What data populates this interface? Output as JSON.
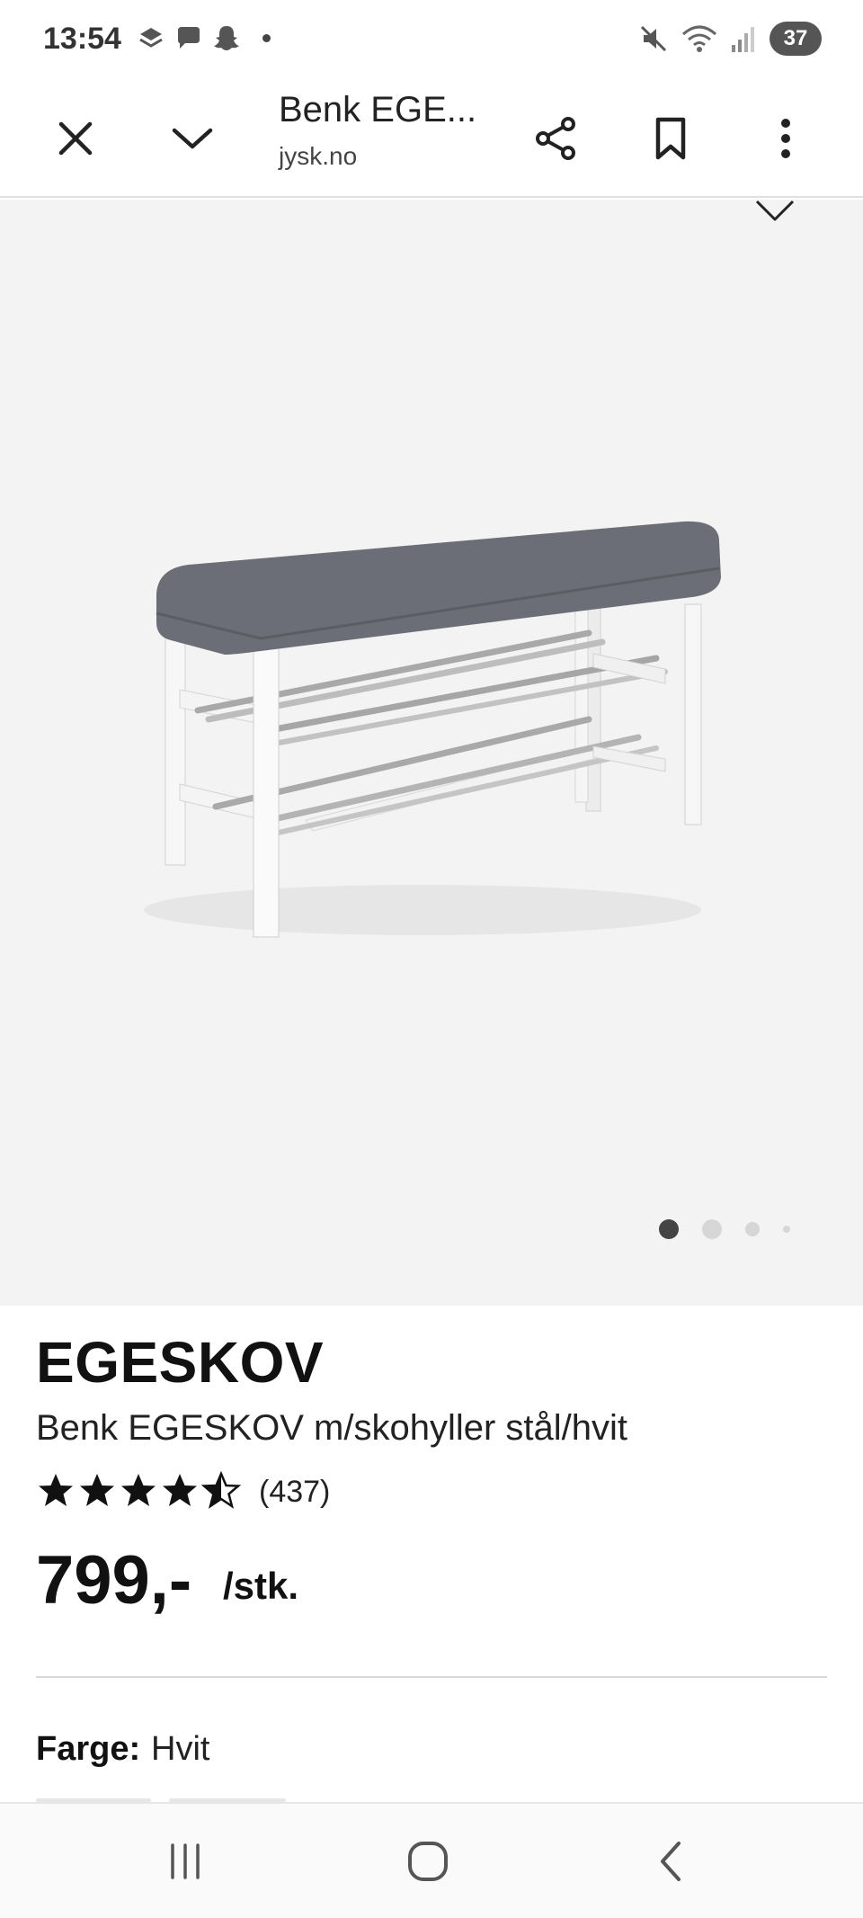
{
  "status_bar": {
    "time": "13:54",
    "left_icons": [
      "layers-icon",
      "chat-icon",
      "snapchat-icon"
    ],
    "right_icons": [
      "mute-icon",
      "wifi-icon",
      "signal-icon"
    ],
    "battery": "37"
  },
  "toolbar": {
    "title": "Benk EGE...",
    "url": "jysk.no",
    "icons": [
      "close-icon",
      "chevron-down-icon",
      "share-icon",
      "bookmark-icon",
      "more-vert-icon"
    ]
  },
  "gallery": {
    "total_images": 4,
    "active_index": 0
  },
  "product": {
    "brand": "EGESKOV",
    "name": "Benk EGESKOV m/skohyller stål/hvit",
    "rating": 4.5,
    "rating_max": 5,
    "review_count": "(437)",
    "price": "799,-",
    "unit": "/stk.",
    "color_label": "Farge:",
    "color_value": "Hvit"
  },
  "nav_bar": {
    "icons": [
      "recent-apps-icon",
      "home-icon",
      "back-icon"
    ]
  },
  "colors": {
    "hero_bg": "#f3f3f3",
    "text": "#111111",
    "seat": "#6b6e76"
  }
}
